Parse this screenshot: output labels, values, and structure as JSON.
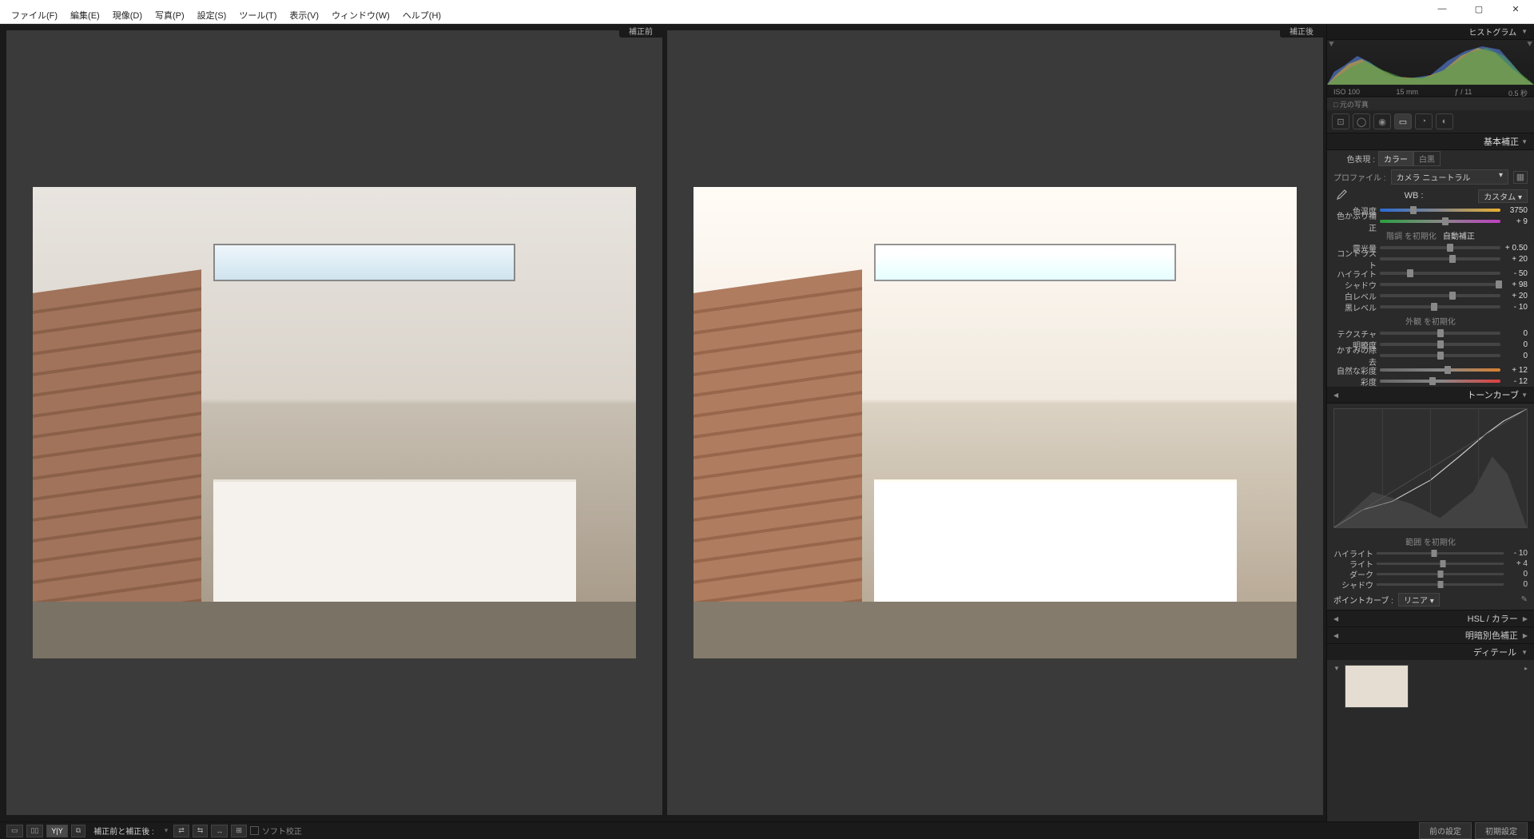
{
  "window": {
    "minimize": "—",
    "maximize": "▢",
    "close": "✕"
  },
  "menubar": [
    "ファイル(F)",
    "編集(E)",
    "現像(D)",
    "写真(P)",
    "設定(S)",
    "ツール(T)",
    "表示(V)",
    "ウィンドウ(W)",
    "ヘルプ(H)"
  ],
  "compare": {
    "before_label": "補正前",
    "after_label": "補正後"
  },
  "histogram": {
    "title": "ヒストグラム",
    "iso": "ISO 100",
    "focal": "15 mm",
    "aperture": "ƒ / 11",
    "shutter": "0.5 秒",
    "source": "□ 元の写真"
  },
  "basic": {
    "title": "基本補正",
    "treatment_label": "色表現 :",
    "treatment_color": "カラー",
    "treatment_bw": "白黒",
    "profile_label": "プロファイル :",
    "profile_value": "カメラ ニュートラル",
    "wb_label": "WB :",
    "wb_value": "カスタム",
    "sliders_wb": [
      {
        "label": "色温度",
        "value": "3750",
        "pos": 28,
        "cls": "temp"
      },
      {
        "label": "色かぶり補正",
        "value": "+ 9",
        "pos": 54,
        "cls": "tint"
      }
    ],
    "tone_head": "階調 を初期化",
    "auto": "自動補正",
    "sliders_tone1": [
      {
        "label": "露光量",
        "value": "+ 0.50",
        "pos": 58
      },
      {
        "label": "コントラスト",
        "value": "+ 20",
        "pos": 60
      }
    ],
    "sliders_tone2": [
      {
        "label": "ハイライト",
        "value": "- 50",
        "pos": 25
      },
      {
        "label": "シャドウ",
        "value": "+ 98",
        "pos": 99
      },
      {
        "label": "白レベル",
        "value": "+ 20",
        "pos": 60
      },
      {
        "label": "黒レベル",
        "value": "- 10",
        "pos": 45
      }
    ],
    "presence_head": "外観 を初期化",
    "sliders_presence": [
      {
        "label": "テクスチャ",
        "value": "0",
        "pos": 50
      },
      {
        "label": "明瞭度",
        "value": "0",
        "pos": 50
      },
      {
        "label": "かすみの除去",
        "value": "0",
        "pos": 50
      }
    ],
    "sliders_color": [
      {
        "label": "自然な彩度",
        "value": "+ 12",
        "pos": 56,
        "cls": "vib"
      },
      {
        "label": "彩度",
        "value": "- 12",
        "pos": 44,
        "cls": "sat"
      }
    ]
  },
  "tonecurve": {
    "title": "トーンカーブ",
    "range_head": "範囲 を初期化",
    "ranges": [
      {
        "label": "ハイライト",
        "value": "- 10",
        "pos": 45
      },
      {
        "label": "ライト",
        "value": "+ 4",
        "pos": 52
      },
      {
        "label": "ダーク",
        "value": "0",
        "pos": 50
      },
      {
        "label": "シャドウ",
        "value": "0",
        "pos": 50
      }
    ],
    "pointcurve_label": "ポイントカーブ :",
    "pointcurve_value": "リニア"
  },
  "collapsed": {
    "hsl": "HSL / カラー",
    "split": "明暗別色補正",
    "detail": "ディテール"
  },
  "bottombar": {
    "view_buttons": [
      "▭",
      "▯▯",
      "Y|Y",
      "⧉"
    ],
    "compare_label": "補正前と補正後 :",
    "swap_buttons": [
      "⇄",
      "⇆",
      "↔",
      "⊞"
    ],
    "softproof": "ソフト校正",
    "prev": "前の設定",
    "reset": "初期設定"
  }
}
